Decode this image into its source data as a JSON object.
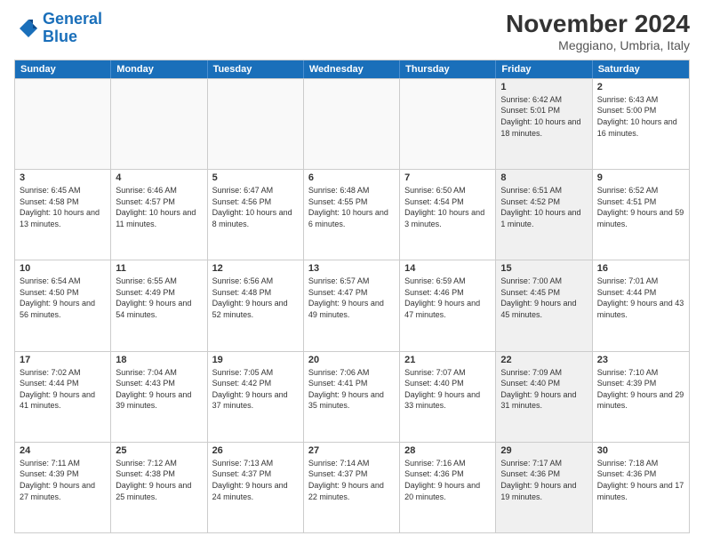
{
  "logo": {
    "line1": "General",
    "line2": "Blue"
  },
  "title": "November 2024",
  "location": "Meggiano, Umbria, Italy",
  "headers": [
    "Sunday",
    "Monday",
    "Tuesday",
    "Wednesday",
    "Thursday",
    "Friday",
    "Saturday"
  ],
  "rows": [
    [
      {
        "day": "",
        "info": "",
        "empty": true
      },
      {
        "day": "",
        "info": "",
        "empty": true
      },
      {
        "day": "",
        "info": "",
        "empty": true
      },
      {
        "day": "",
        "info": "",
        "empty": true
      },
      {
        "day": "",
        "info": "",
        "empty": true
      },
      {
        "day": "1",
        "info": "Sunrise: 6:42 AM\nSunset: 5:01 PM\nDaylight: 10 hours and 18 minutes.",
        "shaded": true
      },
      {
        "day": "2",
        "info": "Sunrise: 6:43 AM\nSunset: 5:00 PM\nDaylight: 10 hours and 16 minutes.",
        "shaded": false
      }
    ],
    [
      {
        "day": "3",
        "info": "Sunrise: 6:45 AM\nSunset: 4:58 PM\nDaylight: 10 hours and 13 minutes.",
        "shaded": false
      },
      {
        "day": "4",
        "info": "Sunrise: 6:46 AM\nSunset: 4:57 PM\nDaylight: 10 hours and 11 minutes.",
        "shaded": false
      },
      {
        "day": "5",
        "info": "Sunrise: 6:47 AM\nSunset: 4:56 PM\nDaylight: 10 hours and 8 minutes.",
        "shaded": false
      },
      {
        "day": "6",
        "info": "Sunrise: 6:48 AM\nSunset: 4:55 PM\nDaylight: 10 hours and 6 minutes.",
        "shaded": false
      },
      {
        "day": "7",
        "info": "Sunrise: 6:50 AM\nSunset: 4:54 PM\nDaylight: 10 hours and 3 minutes.",
        "shaded": false
      },
      {
        "day": "8",
        "info": "Sunrise: 6:51 AM\nSunset: 4:52 PM\nDaylight: 10 hours and 1 minute.",
        "shaded": true
      },
      {
        "day": "9",
        "info": "Sunrise: 6:52 AM\nSunset: 4:51 PM\nDaylight: 9 hours and 59 minutes.",
        "shaded": false
      }
    ],
    [
      {
        "day": "10",
        "info": "Sunrise: 6:54 AM\nSunset: 4:50 PM\nDaylight: 9 hours and 56 minutes.",
        "shaded": false
      },
      {
        "day": "11",
        "info": "Sunrise: 6:55 AM\nSunset: 4:49 PM\nDaylight: 9 hours and 54 minutes.",
        "shaded": false
      },
      {
        "day": "12",
        "info": "Sunrise: 6:56 AM\nSunset: 4:48 PM\nDaylight: 9 hours and 52 minutes.",
        "shaded": false
      },
      {
        "day": "13",
        "info": "Sunrise: 6:57 AM\nSunset: 4:47 PM\nDaylight: 9 hours and 49 minutes.",
        "shaded": false
      },
      {
        "day": "14",
        "info": "Sunrise: 6:59 AM\nSunset: 4:46 PM\nDaylight: 9 hours and 47 minutes.",
        "shaded": false
      },
      {
        "day": "15",
        "info": "Sunrise: 7:00 AM\nSunset: 4:45 PM\nDaylight: 9 hours and 45 minutes.",
        "shaded": true
      },
      {
        "day": "16",
        "info": "Sunrise: 7:01 AM\nSunset: 4:44 PM\nDaylight: 9 hours and 43 minutes.",
        "shaded": false
      }
    ],
    [
      {
        "day": "17",
        "info": "Sunrise: 7:02 AM\nSunset: 4:44 PM\nDaylight: 9 hours and 41 minutes.",
        "shaded": false
      },
      {
        "day": "18",
        "info": "Sunrise: 7:04 AM\nSunset: 4:43 PM\nDaylight: 9 hours and 39 minutes.",
        "shaded": false
      },
      {
        "day": "19",
        "info": "Sunrise: 7:05 AM\nSunset: 4:42 PM\nDaylight: 9 hours and 37 minutes.",
        "shaded": false
      },
      {
        "day": "20",
        "info": "Sunrise: 7:06 AM\nSunset: 4:41 PM\nDaylight: 9 hours and 35 minutes.",
        "shaded": false
      },
      {
        "day": "21",
        "info": "Sunrise: 7:07 AM\nSunset: 4:40 PM\nDaylight: 9 hours and 33 minutes.",
        "shaded": false
      },
      {
        "day": "22",
        "info": "Sunrise: 7:09 AM\nSunset: 4:40 PM\nDaylight: 9 hours and 31 minutes.",
        "shaded": true
      },
      {
        "day": "23",
        "info": "Sunrise: 7:10 AM\nSunset: 4:39 PM\nDaylight: 9 hours and 29 minutes.",
        "shaded": false
      }
    ],
    [
      {
        "day": "24",
        "info": "Sunrise: 7:11 AM\nSunset: 4:39 PM\nDaylight: 9 hours and 27 minutes.",
        "shaded": false
      },
      {
        "day": "25",
        "info": "Sunrise: 7:12 AM\nSunset: 4:38 PM\nDaylight: 9 hours and 25 minutes.",
        "shaded": false
      },
      {
        "day": "26",
        "info": "Sunrise: 7:13 AM\nSunset: 4:37 PM\nDaylight: 9 hours and 24 minutes.",
        "shaded": false
      },
      {
        "day": "27",
        "info": "Sunrise: 7:14 AM\nSunset: 4:37 PM\nDaylight: 9 hours and 22 minutes.",
        "shaded": false
      },
      {
        "day": "28",
        "info": "Sunrise: 7:16 AM\nSunset: 4:36 PM\nDaylight: 9 hours and 20 minutes.",
        "shaded": false
      },
      {
        "day": "29",
        "info": "Sunrise: 7:17 AM\nSunset: 4:36 PM\nDaylight: 9 hours and 19 minutes.",
        "shaded": true
      },
      {
        "day": "30",
        "info": "Sunrise: 7:18 AM\nSunset: 4:36 PM\nDaylight: 9 hours and 17 minutes.",
        "shaded": false
      }
    ]
  ]
}
